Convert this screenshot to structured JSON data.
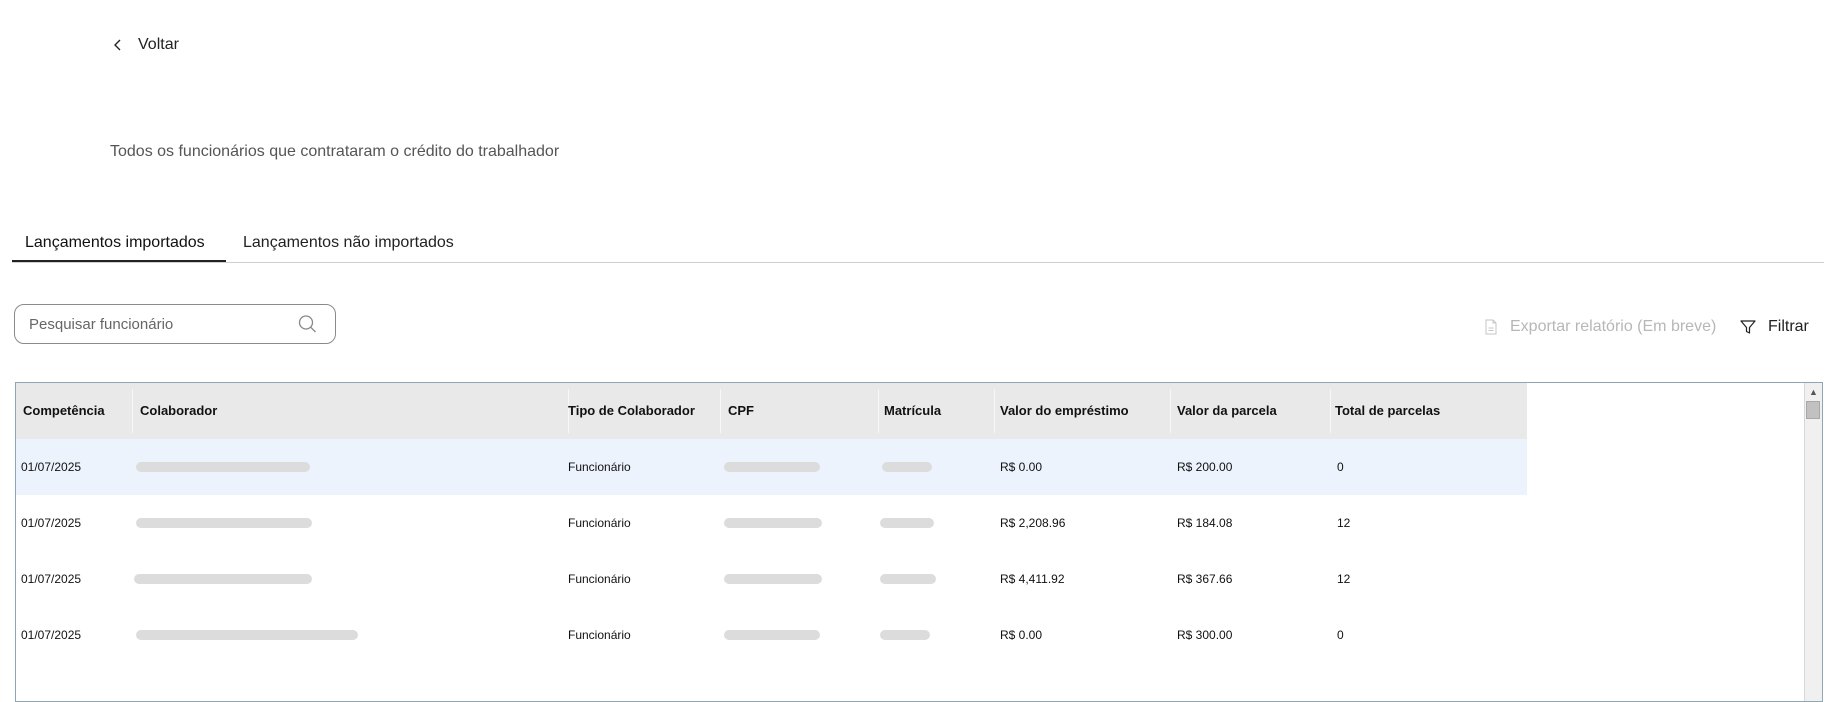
{
  "nav": {
    "back_label": "Voltar"
  },
  "page": {
    "subtitle": "Todos os funcionários que contrataram o crédito do trabalhador"
  },
  "tabs": [
    {
      "label": "Lançamentos importados",
      "active": true
    },
    {
      "label": "Lançamentos não importados",
      "active": false
    }
  ],
  "search": {
    "placeholder": "Pesquisar funcionário",
    "value": ""
  },
  "toolbar": {
    "export_label": "Exportar relatório (Em breve)",
    "filter_label": "Filtrar"
  },
  "table": {
    "columns": [
      "Competência",
      "Colaborador",
      "Tipo de Colaborador",
      "CPF",
      "Matrícula",
      "Valor do empréstimo",
      "Valor da parcela",
      "Total de parcelas"
    ],
    "rows": [
      {
        "competencia": "01/07/2025",
        "colaborador": "",
        "tipo": "Funcionário",
        "cpf": "",
        "matricula": "",
        "valor_emprestimo": "R$ 0.00",
        "valor_parcela": "R$ 200.00",
        "total_parcelas": "0",
        "selected": true
      },
      {
        "competencia": "01/07/2025",
        "colaborador": "",
        "tipo": "Funcionário",
        "cpf": "",
        "matricula": "",
        "valor_emprestimo": "R$ 2,208.96",
        "valor_parcela": "R$ 184.08",
        "total_parcelas": "12",
        "selected": false
      },
      {
        "competencia": "01/07/2025",
        "colaborador": "",
        "tipo": "Funcionário",
        "cpf": "",
        "matricula": "",
        "valor_emprestimo": "R$ 4,411.92",
        "valor_parcela": "R$ 367.66",
        "total_parcelas": "12",
        "selected": false
      },
      {
        "competencia": "01/07/2025",
        "colaborador": "",
        "tipo": "Funcionário",
        "cpf": "",
        "matricula": "",
        "valor_emprestimo": "R$ 0.00",
        "valor_parcela": "R$ 300.00",
        "total_parcelas": "0",
        "selected": false
      }
    ]
  },
  "icons": {
    "back": "chevron-left-icon",
    "search": "search-icon",
    "export": "document-icon",
    "filter": "funnel-icon"
  },
  "colors": {
    "selected_row": "#edf3fd",
    "header_bg": "#e9e9e9",
    "disabled_text": "#b7b7b7"
  }
}
